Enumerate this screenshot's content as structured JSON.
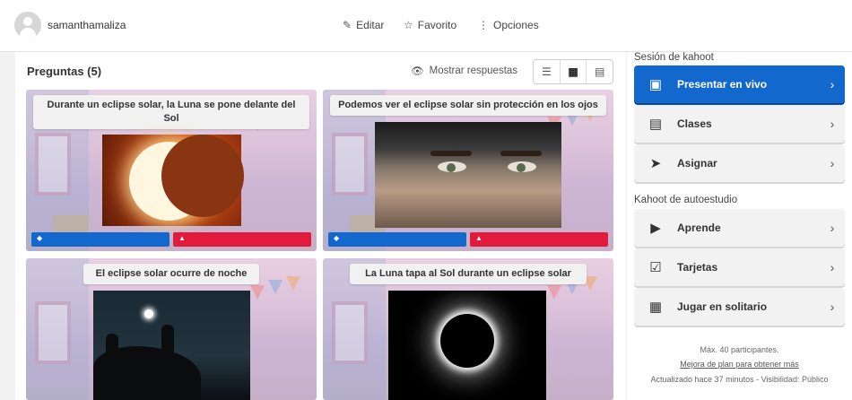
{
  "header": {
    "username": "samanthamaliza",
    "actions": [
      {
        "label": "Editar",
        "icon": "pencil-icon"
      },
      {
        "label": "Favorito",
        "icon": "star-icon"
      },
      {
        "label": "Opciones",
        "icon": "more-vertical-icon"
      }
    ]
  },
  "questions": {
    "title": "Preguntas (5)",
    "show_answers_label": "Mostrar respuestas",
    "view_modes": [
      "list-view-icon",
      "grid-view-icon",
      "detail-view-icon"
    ],
    "cards": [
      {
        "text": "Durante un eclipse solar, la Luna se pone delante del Sol",
        "image": "partial-solar-eclipse",
        "answer_symbols": [
          "◆",
          "▲"
        ]
      },
      {
        "text": "Podemos ver el eclipse solar sin protección en los ojos",
        "image": "close-up-eyes",
        "answer_symbols": [
          "◆",
          "▲"
        ]
      },
      {
        "text": "El eclipse solar ocurre de noche",
        "image": "night-silhouettes",
        "answer_symbols": []
      },
      {
        "text": "La Luna tapa al Sol durante un eclipse solar",
        "image": "total-solar-eclipse",
        "answer_symbols": []
      }
    ]
  },
  "sidebar": {
    "session_heading": "Sesión de kahoot",
    "session_buttons": [
      {
        "label": "Presentar en vivo",
        "icon": "present-screen-icon"
      },
      {
        "label": "Clases",
        "icon": "class-board-icon"
      },
      {
        "label": "Asignar",
        "icon": "send-plane-icon"
      }
    ],
    "self_study_heading": "Kahoot de autoestudio",
    "self_study_buttons": [
      {
        "label": "Aprende",
        "icon": "play-cards-icon"
      },
      {
        "label": "Tarjetas",
        "icon": "flashcard-check-icon"
      },
      {
        "label": "Jugar en solitario",
        "icon": "grid-solo-icon"
      }
    ],
    "footer": {
      "max_players": "Máx. 40 participantes.",
      "upgrade_link": "Mejora de plan para obtener más",
      "updated": "Actualizado hace 37 minutos - Visibilidad: Público"
    }
  },
  "colors": {
    "primary": "#1368ce",
    "answer_blue": "#1368ce",
    "answer_red": "#e21b3c"
  }
}
